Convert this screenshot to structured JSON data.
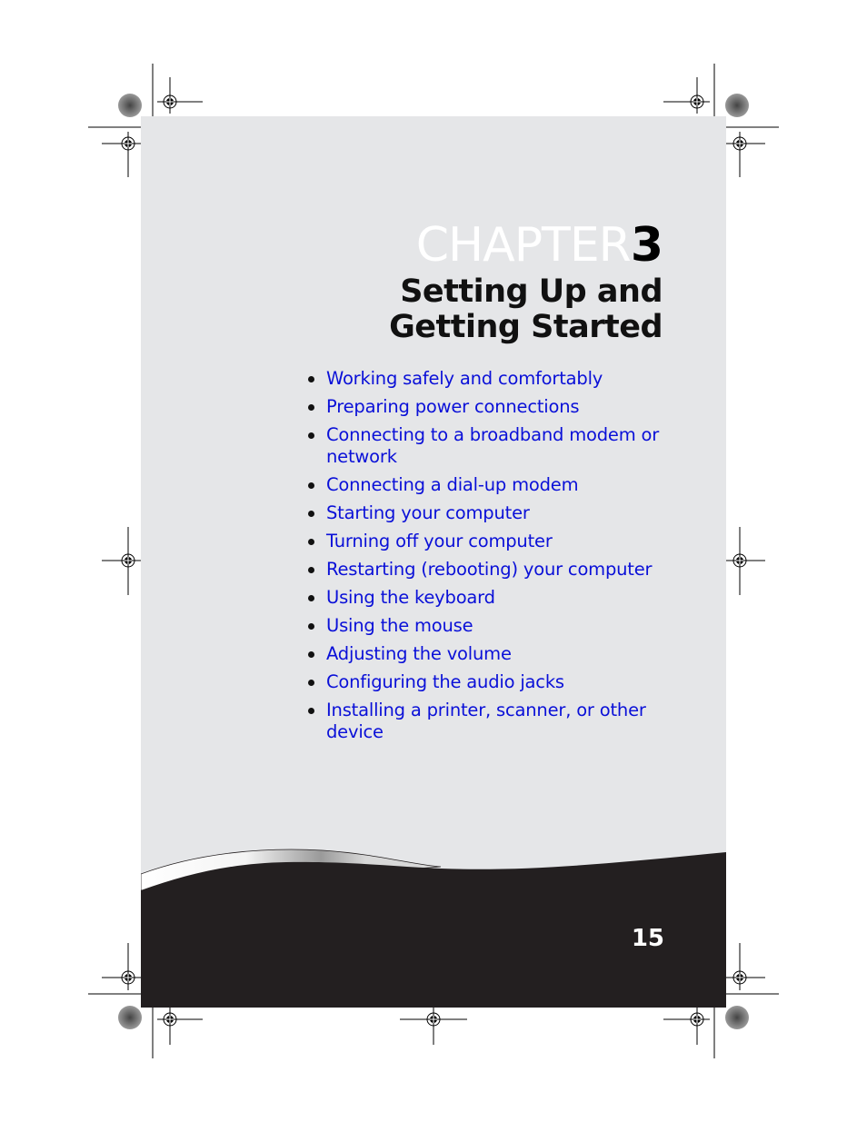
{
  "chapter": {
    "word": "CHAPTER",
    "number": "3",
    "title": "Setting Up and Getting Started"
  },
  "topics": [
    "Working safely and comfortably",
    "Preparing power connections",
    "Connecting to a broadband modem or network",
    "Connecting a dial-up modem",
    "Starting your computer",
    "Turning off your computer",
    "Restarting (rebooting) your computer",
    "Using the keyboard",
    "Using the mouse",
    "Adjusting the volume",
    "Configuring the audio jacks",
    "Installing a printer, scanner, or other device"
  ],
  "footer": {
    "page_number": "15"
  },
  "colors": {
    "link": "#0a10d8",
    "page_bg": "#e5e6e8",
    "footer_bg": "#231f20"
  }
}
